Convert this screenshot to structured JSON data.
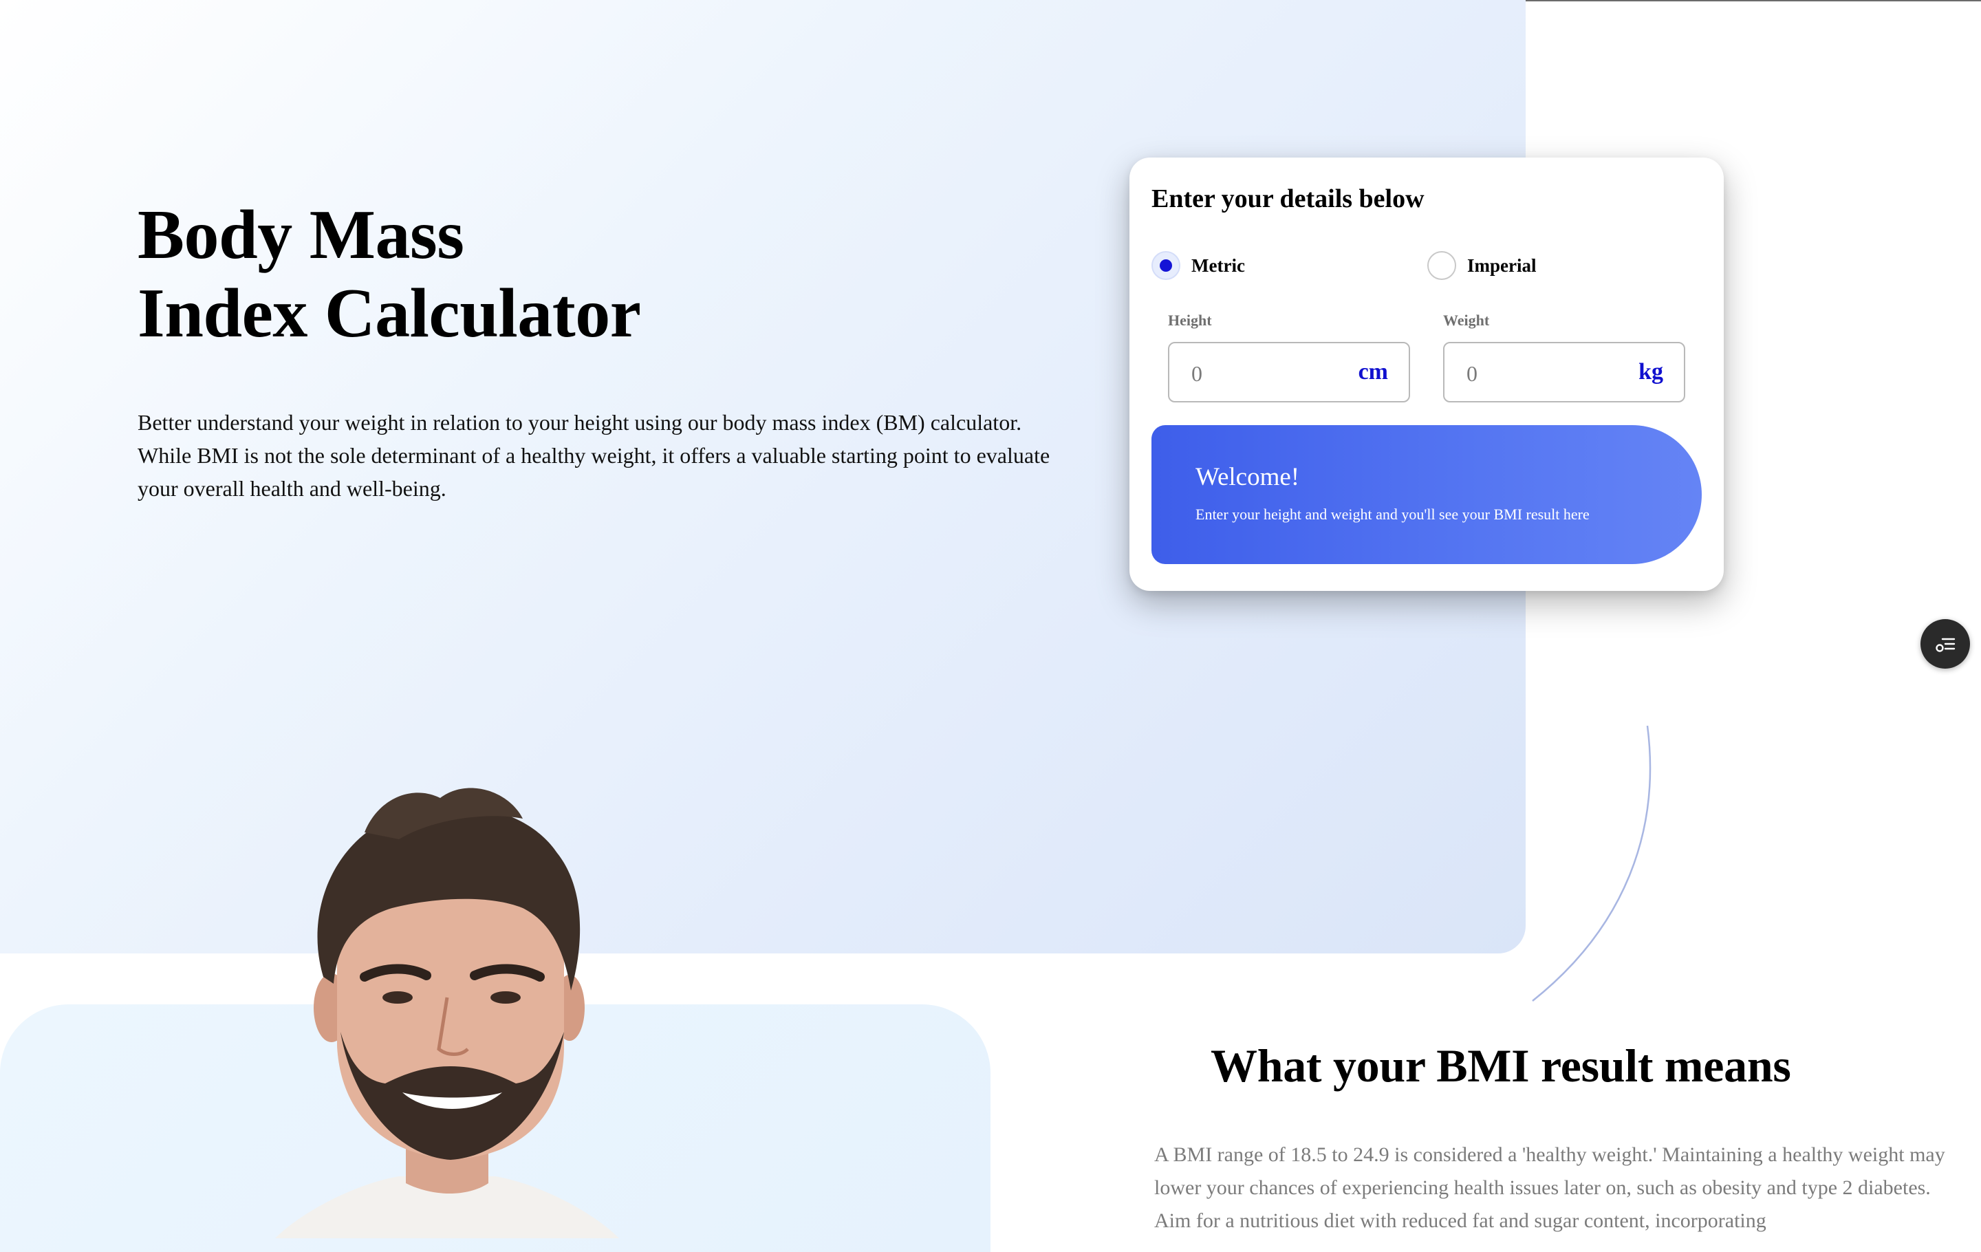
{
  "hero": {
    "title_line1": "Body Mass",
    "title_line2": "Index Calculator",
    "description": "Better understand your weight in relation to your height using our body mass index (BM) calculator. While BMI is not the sole determinant of a healthy weight, it offers a valuable starting point to evaluate your overall health and well-being."
  },
  "calculator": {
    "title": "Enter your details below",
    "units": {
      "metric_label": "Metric",
      "imperial_label": "Imperial",
      "selected": "Metric"
    },
    "height": {
      "label": "Height",
      "placeholder": "0",
      "unit": "cm"
    },
    "weight": {
      "label": "Weight",
      "placeholder": "0",
      "unit": "kg"
    },
    "result": {
      "heading": "Welcome!",
      "message": "Enter your height and weight and you'll see your BMI result here"
    }
  },
  "fab": {
    "icon": "settings-list-icon"
  },
  "bmi_info": {
    "title": "What your BMI result means",
    "text": "A BMI range of 18.5 to 24.9 is considered a 'healthy weight.' Maintaining a healthy weight may lower your chances of experiencing health issues later on, such as obesity and type 2 diabetes. Aim for a nutritious diet with reduced fat and sugar content, incorporating"
  },
  "colors": {
    "accent": "#1414d6",
    "result_gradient_start": "#3e5eea",
    "result_gradient_end": "#6584f5",
    "hero_bg": "#e3ecfb"
  }
}
